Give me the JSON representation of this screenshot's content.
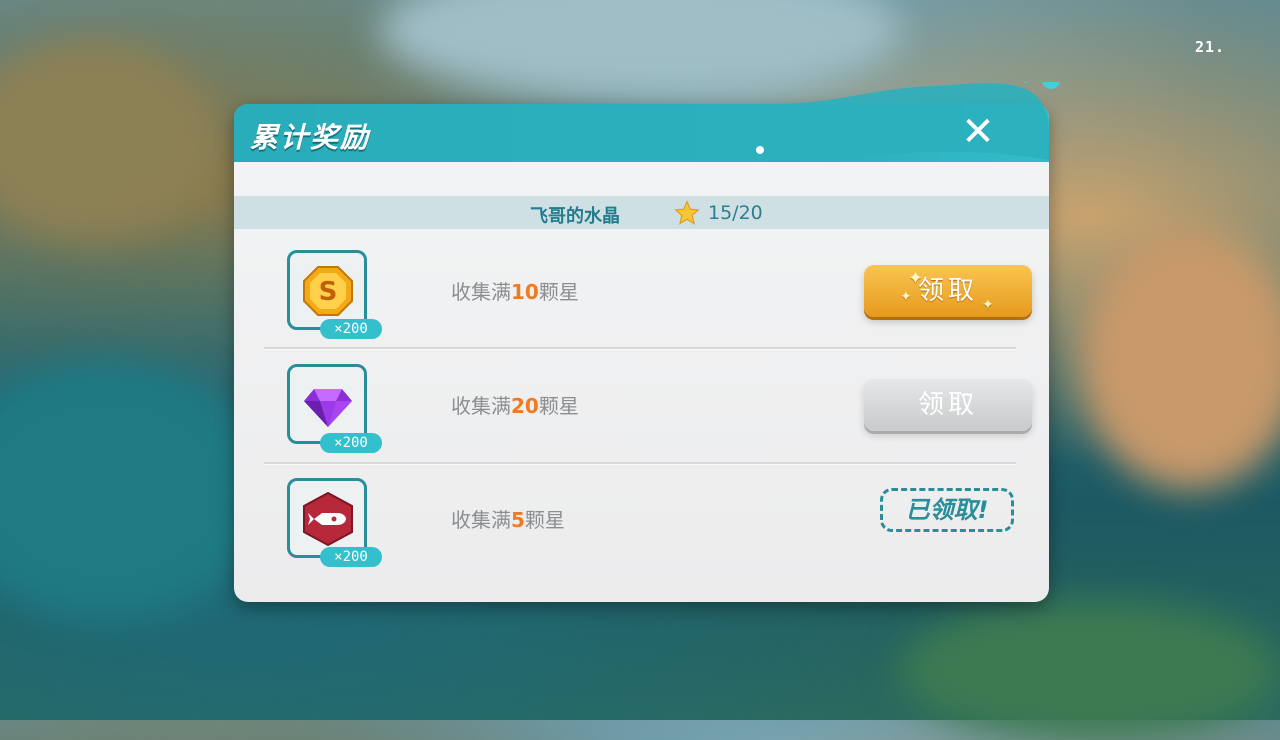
{
  "page_number": "21.",
  "dialog": {
    "title": "累计奖励",
    "close_icon": "close-icon",
    "header_color": "#2aa9b8"
  },
  "collection": {
    "name": "飞哥的水晶",
    "star_icon": "star-icon",
    "progress": "15/20"
  },
  "rewards": [
    {
      "icon": "gold-coin-icon",
      "quantity": "×200",
      "condition_prefix": "收集满",
      "condition_number": "10",
      "condition_suffix": "颗星",
      "action_label": "领取",
      "state": "available"
    },
    {
      "icon": "purple-gem-icon",
      "quantity": "×200",
      "condition_prefix": "收集满",
      "condition_number": "20",
      "condition_suffix": "颗星",
      "action_label": "领取",
      "state": "locked"
    },
    {
      "icon": "rocket-badge-icon",
      "quantity": "×200",
      "condition_prefix": "收集满",
      "condition_number": "5",
      "condition_suffix": "颗星",
      "action_label": "已领取!",
      "state": "claimed"
    }
  ],
  "colors": {
    "accent_teal": "#2a8d9a",
    "highlight_orange": "#f07a20",
    "gold_button": "#e69a1c"
  }
}
